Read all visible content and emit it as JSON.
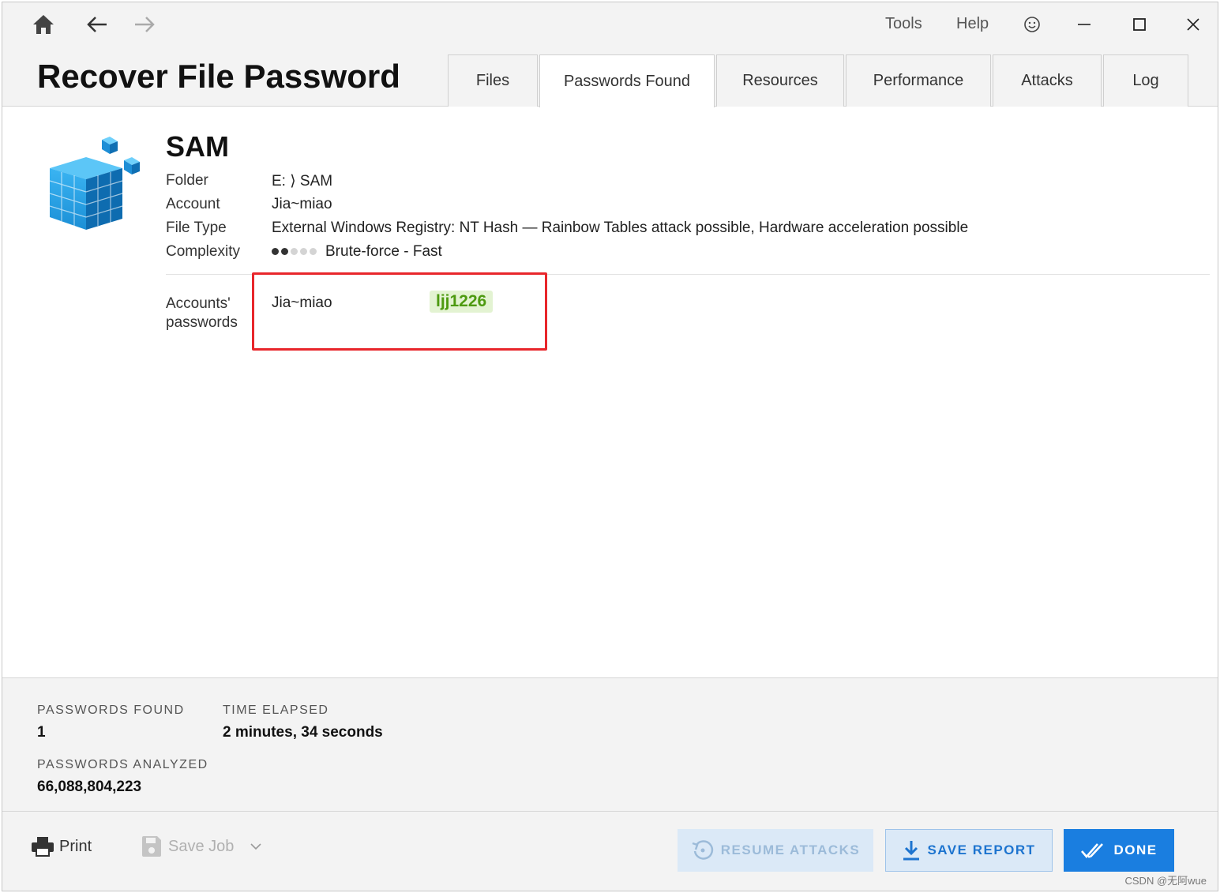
{
  "menu": {
    "tools": "Tools",
    "help": "Help"
  },
  "app_title": "Recover File Password",
  "tabs": [
    {
      "label": "Files"
    },
    {
      "label": "Passwords Found"
    },
    {
      "label": "Resources"
    },
    {
      "label": "Performance"
    },
    {
      "label": "Attacks"
    },
    {
      "label": "Log"
    }
  ],
  "active_tab": "Passwords Found",
  "file": {
    "name": "SAM",
    "props": [
      {
        "label": "Folder",
        "value": "E: ⟩ SAM"
      },
      {
        "label": "Account",
        "value": "Jia~miao"
      },
      {
        "label": "File Type",
        "value": "External Windows Registry: NT Hash — Rainbow Tables attack possible, Hardware acceleration possible"
      },
      {
        "label": "Complexity",
        "value": "Brute-force - Fast"
      }
    ],
    "complexity_level": 2,
    "complexity_max": 5
  },
  "accounts": {
    "label": "Accounts' passwords",
    "items": [
      {
        "account": "Jia~miao",
        "password": "ljj1226"
      }
    ]
  },
  "stats": {
    "passwords_found_label": "PASSWORDS FOUND",
    "passwords_found_value": "1",
    "time_elapsed_label": "TIME ELAPSED",
    "time_elapsed_value": "2 minutes, 34 seconds",
    "passwords_analyzed_label": "PASSWORDS ANALYZED",
    "passwords_analyzed_value": "66,088,804,223"
  },
  "bottom": {
    "print": "Print",
    "save_job": "Save Job",
    "resume": "RESUME ATTACKS",
    "save_report": "SAVE REPORT",
    "done": "DONE"
  },
  "watermark": "CSDN @无阿wue",
  "colors": {
    "accent": "#1a7ee0",
    "password_green": "#4d9a10",
    "highlight_red": "#e8262b"
  }
}
